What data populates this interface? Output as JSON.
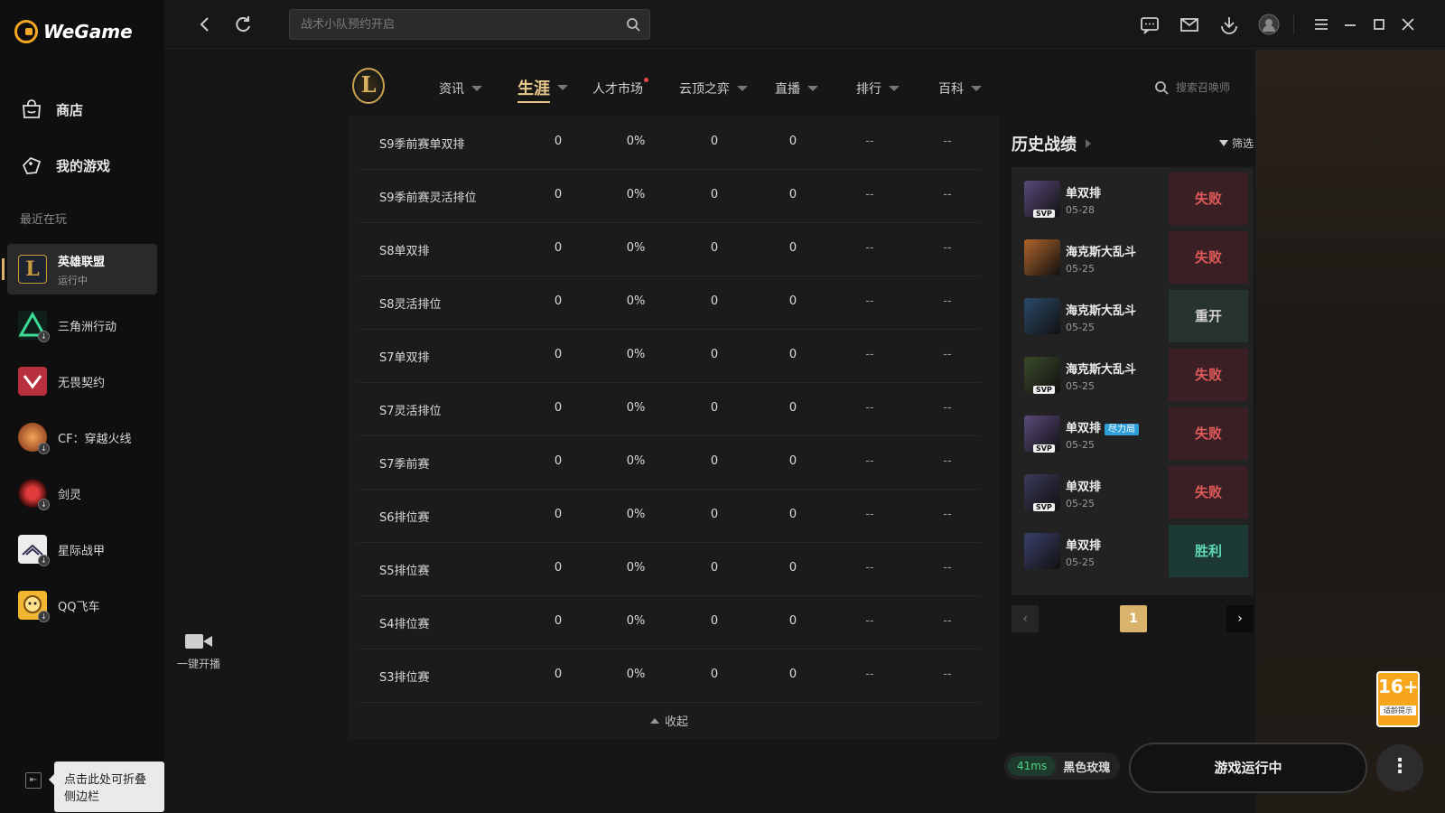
{
  "app": {
    "brand": "WeGame"
  },
  "sidebar": {
    "nav": [
      {
        "label": "商店",
        "icon": "shop-icon"
      },
      {
        "label": "我的游戏",
        "icon": "gamepad-icon"
      }
    ],
    "recent_label": "最近在玩",
    "games": [
      {
        "name": "英雄联盟",
        "status": "运行中",
        "color": "#c89b3c"
      },
      {
        "name": "三角洲行动",
        "status": "",
        "color": "#1f6b4f"
      },
      {
        "name": "无畏契约",
        "status": "",
        "color": "#b8303d"
      },
      {
        "name": "CF：穿越火线",
        "status": "",
        "color": "#d2532a"
      },
      {
        "name": "剑灵",
        "status": "",
        "color": "#b7242a"
      },
      {
        "name": "星际战甲",
        "status": "",
        "color": "#e6e6e6"
      },
      {
        "name": "QQ飞车",
        "status": "",
        "color": "#f0b531"
      }
    ],
    "tooltip": "点击此处可折叠侧边栏",
    "stream_label": "一键开播"
  },
  "topbar": {
    "search_placeholder": "战术小队预约开启"
  },
  "game_nav": {
    "logo_letter": "L",
    "tabs": [
      {
        "label": "资讯"
      },
      {
        "label": "生涯"
      },
      {
        "label": "人才市场"
      },
      {
        "label": "云顶之弈"
      },
      {
        "label": "直播"
      },
      {
        "label": "排行"
      },
      {
        "label": "百科"
      }
    ],
    "summoner_search_placeholder": "搜索召唤师"
  },
  "stats": {
    "rows": [
      {
        "name": "S9季前赛单双排",
        "v1": "0",
        "v2": "0%",
        "v3": "0",
        "v4": "0",
        "v5": "--",
        "v6": "--"
      },
      {
        "name": "S9季前赛灵活排位",
        "v1": "0",
        "v2": "0%",
        "v3": "0",
        "v4": "0",
        "v5": "--",
        "v6": "--"
      },
      {
        "name": "S8单双排",
        "v1": "0",
        "v2": "0%",
        "v3": "0",
        "v4": "0",
        "v5": "--",
        "v6": "--"
      },
      {
        "name": "S8灵活排位",
        "v1": "0",
        "v2": "0%",
        "v3": "0",
        "v4": "0",
        "v5": "--",
        "v6": "--"
      },
      {
        "name": "S7单双排",
        "v1": "0",
        "v2": "0%",
        "v3": "0",
        "v4": "0",
        "v5": "--",
        "v6": "--"
      },
      {
        "name": "S7灵活排位",
        "v1": "0",
        "v2": "0%",
        "v3": "0",
        "v4": "0",
        "v5": "--",
        "v6": "--"
      },
      {
        "name": "S7季前赛",
        "v1": "0",
        "v2": "0%",
        "v3": "0",
        "v4": "0",
        "v5": "--",
        "v6": "--"
      },
      {
        "name": "S6排位赛",
        "v1": "0",
        "v2": "0%",
        "v3": "0",
        "v4": "0",
        "v5": "--",
        "v6": "--"
      },
      {
        "name": "S5排位赛",
        "v1": "0",
        "v2": "0%",
        "v3": "0",
        "v4": "0",
        "v5": "--",
        "v6": "--"
      },
      {
        "name": "S4排位赛",
        "v1": "0",
        "v2": "0%",
        "v3": "0",
        "v4": "0",
        "v5": "--",
        "v6": "--"
      },
      {
        "name": "S3排位赛",
        "v1": "0",
        "v2": "0%",
        "v3": "0",
        "v4": "0",
        "v5": "--",
        "v6": "--"
      }
    ],
    "collapse_label": "收起"
  },
  "history": {
    "title": "历史战绩",
    "filter_label": "筛选",
    "matches": [
      {
        "mode": "单双排",
        "date": "05-28",
        "result": "失败",
        "type": "loss",
        "svp": "SVP",
        "badge": "",
        "champ_color": "#5a4a7a"
      },
      {
        "mode": "海克斯大乱斗",
        "date": "05-25",
        "result": "失败",
        "type": "loss",
        "svp": "",
        "badge": "",
        "champ_color": "#b0642a"
      },
      {
        "mode": "海克斯大乱斗",
        "date": "05-25",
        "result": "重开",
        "type": "remake",
        "svp": "",
        "badge": "",
        "champ_color": "#2c4a6a"
      },
      {
        "mode": "海克斯大乱斗",
        "date": "05-25",
        "result": "失败",
        "type": "loss",
        "svp": "SVP",
        "badge": "",
        "champ_color": "#3a4a2a"
      },
      {
        "mode": "单双排",
        "date": "05-25",
        "result": "失败",
        "type": "loss",
        "svp": "SVP",
        "badge": "尽力局",
        "champ_color": "#5a4a7a"
      },
      {
        "mode": "单双排",
        "date": "05-25",
        "result": "失败",
        "type": "loss",
        "svp": "SVP",
        "badge": "",
        "champ_color": "#3a3a5a"
      },
      {
        "mode": "单双排",
        "date": "05-25",
        "result": "胜利",
        "type": "win",
        "svp": "",
        "badge": "",
        "champ_color": "#3a3f6a"
      }
    ],
    "page": "1"
  },
  "bottom": {
    "ping": "41ms",
    "server": "黑色玫瑰",
    "running_label": "游戏运行中",
    "age_rating": "16+",
    "age_note": "适龄提示"
  }
}
